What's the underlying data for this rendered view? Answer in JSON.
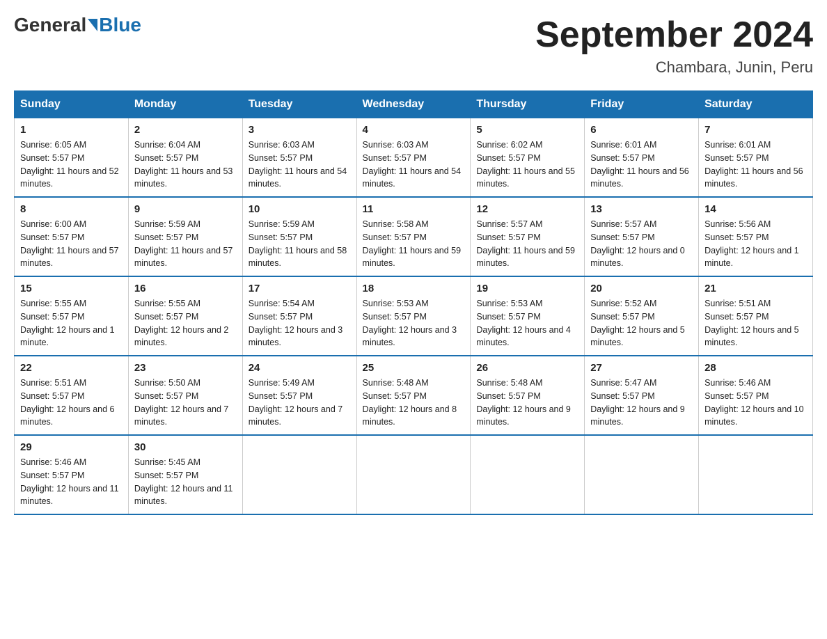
{
  "header": {
    "logo_general": "General",
    "logo_blue": "Blue",
    "title": "September 2024",
    "location": "Chambara, Junin, Peru"
  },
  "days_of_week": [
    "Sunday",
    "Monday",
    "Tuesday",
    "Wednesday",
    "Thursday",
    "Friday",
    "Saturday"
  ],
  "weeks": [
    [
      {
        "day": "1",
        "sunrise": "6:05 AM",
        "sunset": "5:57 PM",
        "daylight": "11 hours and 52 minutes."
      },
      {
        "day": "2",
        "sunrise": "6:04 AM",
        "sunset": "5:57 PM",
        "daylight": "11 hours and 53 minutes."
      },
      {
        "day": "3",
        "sunrise": "6:03 AM",
        "sunset": "5:57 PM",
        "daylight": "11 hours and 54 minutes."
      },
      {
        "day": "4",
        "sunrise": "6:03 AM",
        "sunset": "5:57 PM",
        "daylight": "11 hours and 54 minutes."
      },
      {
        "day": "5",
        "sunrise": "6:02 AM",
        "sunset": "5:57 PM",
        "daylight": "11 hours and 55 minutes."
      },
      {
        "day": "6",
        "sunrise": "6:01 AM",
        "sunset": "5:57 PM",
        "daylight": "11 hours and 56 minutes."
      },
      {
        "day": "7",
        "sunrise": "6:01 AM",
        "sunset": "5:57 PM",
        "daylight": "11 hours and 56 minutes."
      }
    ],
    [
      {
        "day": "8",
        "sunrise": "6:00 AM",
        "sunset": "5:57 PM",
        "daylight": "11 hours and 57 minutes."
      },
      {
        "day": "9",
        "sunrise": "5:59 AM",
        "sunset": "5:57 PM",
        "daylight": "11 hours and 57 minutes."
      },
      {
        "day": "10",
        "sunrise": "5:59 AM",
        "sunset": "5:57 PM",
        "daylight": "11 hours and 58 minutes."
      },
      {
        "day": "11",
        "sunrise": "5:58 AM",
        "sunset": "5:57 PM",
        "daylight": "11 hours and 59 minutes."
      },
      {
        "day": "12",
        "sunrise": "5:57 AM",
        "sunset": "5:57 PM",
        "daylight": "11 hours and 59 minutes."
      },
      {
        "day": "13",
        "sunrise": "5:57 AM",
        "sunset": "5:57 PM",
        "daylight": "12 hours and 0 minutes."
      },
      {
        "day": "14",
        "sunrise": "5:56 AM",
        "sunset": "5:57 PM",
        "daylight": "12 hours and 1 minute."
      }
    ],
    [
      {
        "day": "15",
        "sunrise": "5:55 AM",
        "sunset": "5:57 PM",
        "daylight": "12 hours and 1 minute."
      },
      {
        "day": "16",
        "sunrise": "5:55 AM",
        "sunset": "5:57 PM",
        "daylight": "12 hours and 2 minutes."
      },
      {
        "day": "17",
        "sunrise": "5:54 AM",
        "sunset": "5:57 PM",
        "daylight": "12 hours and 3 minutes."
      },
      {
        "day": "18",
        "sunrise": "5:53 AM",
        "sunset": "5:57 PM",
        "daylight": "12 hours and 3 minutes."
      },
      {
        "day": "19",
        "sunrise": "5:53 AM",
        "sunset": "5:57 PM",
        "daylight": "12 hours and 4 minutes."
      },
      {
        "day": "20",
        "sunrise": "5:52 AM",
        "sunset": "5:57 PM",
        "daylight": "12 hours and 5 minutes."
      },
      {
        "day": "21",
        "sunrise": "5:51 AM",
        "sunset": "5:57 PM",
        "daylight": "12 hours and 5 minutes."
      }
    ],
    [
      {
        "day": "22",
        "sunrise": "5:51 AM",
        "sunset": "5:57 PM",
        "daylight": "12 hours and 6 minutes."
      },
      {
        "day": "23",
        "sunrise": "5:50 AM",
        "sunset": "5:57 PM",
        "daylight": "12 hours and 7 minutes."
      },
      {
        "day": "24",
        "sunrise": "5:49 AM",
        "sunset": "5:57 PM",
        "daylight": "12 hours and 7 minutes."
      },
      {
        "day": "25",
        "sunrise": "5:48 AM",
        "sunset": "5:57 PM",
        "daylight": "12 hours and 8 minutes."
      },
      {
        "day": "26",
        "sunrise": "5:48 AM",
        "sunset": "5:57 PM",
        "daylight": "12 hours and 9 minutes."
      },
      {
        "day": "27",
        "sunrise": "5:47 AM",
        "sunset": "5:57 PM",
        "daylight": "12 hours and 9 minutes."
      },
      {
        "day": "28",
        "sunrise": "5:46 AM",
        "sunset": "5:57 PM",
        "daylight": "12 hours and 10 minutes."
      }
    ],
    [
      {
        "day": "29",
        "sunrise": "5:46 AM",
        "sunset": "5:57 PM",
        "daylight": "12 hours and 11 minutes."
      },
      {
        "day": "30",
        "sunrise": "5:45 AM",
        "sunset": "5:57 PM",
        "daylight": "12 hours and 11 minutes."
      },
      null,
      null,
      null,
      null,
      null
    ]
  ],
  "labels": {
    "sunrise_prefix": "Sunrise: ",
    "sunset_prefix": "Sunset: ",
    "daylight_prefix": "Daylight: "
  }
}
